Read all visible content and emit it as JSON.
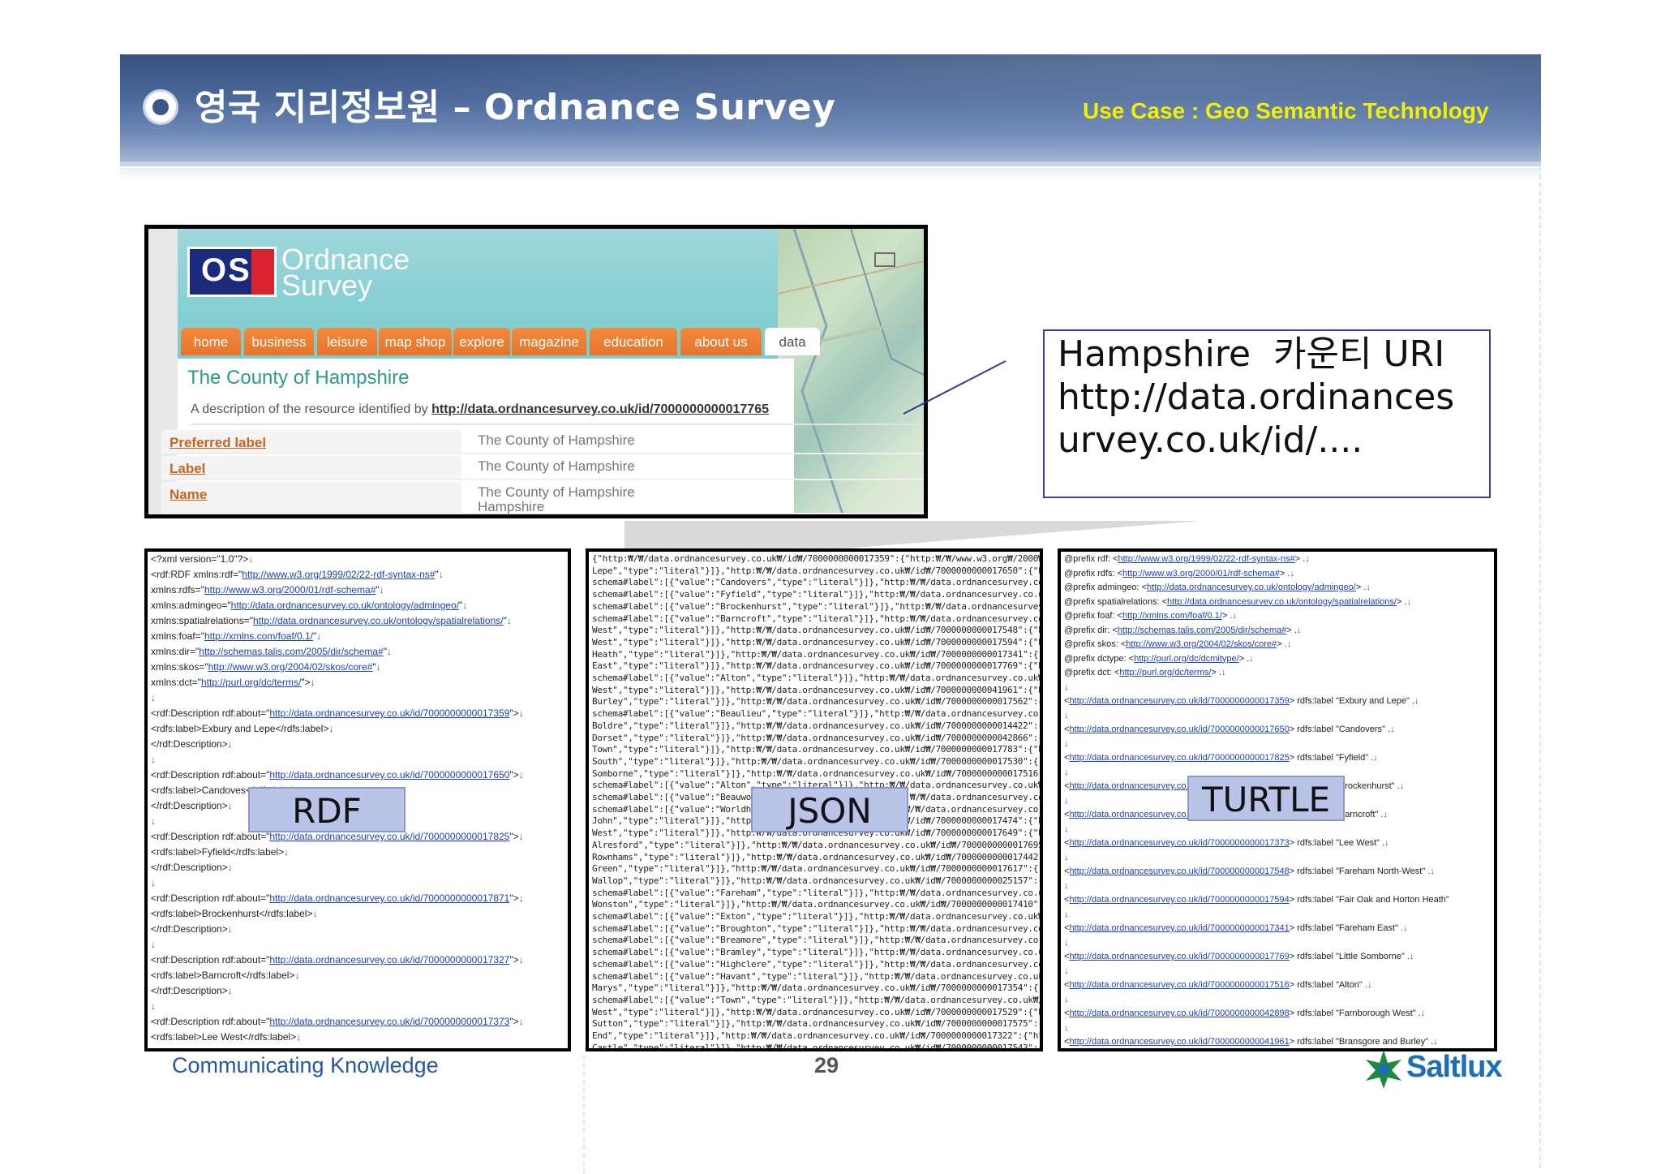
{
  "header": {
    "title": "영국 지리정보원 – Ordnance Survey",
    "use_case": "Use Case : Geo Semantic Technology"
  },
  "os_site": {
    "logo_mark": "OS",
    "logo_line1": "Ordnance",
    "logo_line2": "Survey",
    "nav": [
      "home",
      "business",
      "leisure",
      "map shop",
      "explore",
      "magazine",
      "education",
      "about us",
      "data"
    ],
    "active_tab": "data",
    "heading": "The County of Hampshire",
    "description_prefix": "A description of the resource identified by",
    "description_uri": "http://data.ordnancesurvey.co.uk/id/7000000000017765",
    "rows": [
      {
        "key": "Preferred label",
        "value": "The County of Hampshire"
      },
      {
        "key": "Label",
        "value": "The County of Hampshire"
      },
      {
        "key": "Name",
        "value": "The County of Hampshire",
        "value2": "Hampshire"
      }
    ]
  },
  "callout": {
    "text": "Hampshire  카운티 URI\nhttp://data.ordinancesurvey.co.uk/id/...."
  },
  "panels": {
    "rdf_label": "RDF",
    "json_label": "JSON",
    "turtle_label": "TURTLE",
    "rdf_lines": [
      "<?xml version=\"1.0\"?>↓",
      "<rdf:RDF xmlns:rdf=\"|http://www.w3.org/1999/02/22-rdf-syntax-ns#|\"↓",
      "   xmlns:rdfs=\"|http://www.w3.org/2000/01/rdf-schema#|\"↓",
      "   xmlns:admingeo=\"|http://data.ordnancesurvey.co.uk/ontology/admingeo/|\"↓",
      "   xmlns:spatialrelations=\"|http://data.ordnancesurvey.co.uk/ontology/spatialrelations/|\"↓",
      "   xmlns:foaf=\"|http://xmlns.com/foaf/0.1/|\"↓",
      "   xmlns:dir=\"|http://schemas.talis.com/2005/dir/schema#|\"↓",
      "   xmlns:skos=\"|http://www.w3.org/2004/02/skos/core#|\"↓",
      "   xmlns:dct=\"|http://purl.org/dc/terms/|\">↓",
      "↓",
      "  <rdf:Description rdf:about=\"|http://data.ordnancesurvey.co.uk/id/7000000000017359|\">↓",
      "    <rdfs:label>Exbury and Lepe</rdfs:label>↓",
      "  </rdf:Description>↓",
      "↓",
      "  <rdf:Description rdf:about=\"|http://data.ordnancesurvey.co.uk/id/7000000000017650|\">↓",
      "    <rdfs:label>Candoves</rdfs:label>↓",
      "  </rdf:Description>↓",
      "↓",
      "  <rdf:Description rdf:about=\"|http://data.ordnancesurvey.co.uk/id/7000000000017825|\">↓",
      "    <rdfs:label>Fyfield</rdfs:label>↓",
      "  </rdf:Description>↓",
      "↓",
      "  <rdf:Description rdf:about=\"|http://data.ordnancesurvey.co.uk/id/7000000000017871|\">↓",
      "    <rdfs:label>Brockenhurst</rdfs:label>↓",
      "  </rdf:Description>↓",
      "↓",
      "  <rdf:Description rdf:about=\"|http://data.ordnancesurvey.co.uk/id/7000000000017327|\">↓",
      "    <rdfs:label>Barncroft</rdfs:label>↓",
      "  </rdf:Description>↓",
      "↓",
      "  <rdf:Description rdf:about=\"|http://data.ordnancesurvey.co.uk/id/7000000000017373|\">↓",
      "    <rdfs:label>Lee West</rdfs:label>↓"
    ],
    "json_lines": [
      "{\"http:₩/₩/data.ordnancesurvey.co.uk₩/id₩/7000000000017359\":{\"http:₩/₩/www.w3.org₩/2000₩/01₩/rd",
      "Lepe\",\"type\":\"literal\"}]},\"http:₩/₩/data.ordnancesurvey.co.uk₩/id₩/7000000000017650\":{\"http:₩/₩/",
      "schema#label\":[{\"value\":\"Candovers\",\"type\":\"literal\"}]},\"http:₩/₩/data.ordnancesurvey.co.uk₩/id₩/",
      "schema#label\":[{\"value\":\"Fyfield\",\"type\":\"literal\"}]},\"http:₩/₩/data.ordnancesurvey.co.uk₩/id₩/7",
      "schema#label\":[{\"value\":\"Brockenhurst\",\"type\":\"literal\"}]},\"http:₩/₩/data.ordnancesurvey.co.uk₩/",
      "schema#label\":[{\"value\":\"Barncroft\",\"type\":\"literal\"}]},\"http:₩/₩/data.ordnancesurvey.co.uk₩/id₩",
      "West\",\"type\":\"literal\"}]},\"http:₩/₩/data.ordnancesurvey.co.uk₩/id₩/7000000000017548\":{\"http:₩/₩/",
      "West\",\"type\":\"literal\"}]},\"http:₩/₩/data.ordnancesurvey.co.uk₩/id₩/7000000000017594\":{\"http:₩/₩/",
      "Heath\",\"type\":\"literal\"}]},\"http:₩/₩/data.ordnancesurvey.co.uk₩/id₩/7000000000017341\":{\"http:₩/₩",
      "East\",\"type\":\"literal\"}]},\"http:₩/₩/data.ordnancesurvey.co.uk₩/id₩/7000000000017769\":{\"http:₩/₩/",
      "schema#label\":[{\"value\":\"Alton\",\"type\":\"literal\"}]},\"http:₩/₩/data.ordnancesurvey.co.uk₩/id₩/70",
      "West\",\"type\":\"literal\"}]},\"http:₩/₩/data.ordnancesurvey.co.uk₩/id₩/7000000000041961\":{\"http:₩/₩/",
      "Burley\",\"type\":\"literal\"}]},\"http:₩/₩/data.ordnancesurvey.co.uk₩/id₩/7000000000017562\":{\"http:₩/",
      "schema#label\":[{\"value\":\"Beaulieu\",\"type\":\"literal\"}]},\"http:₩/₩/data.ordnancesurvey.co.uk₩/id₩",
      "Boldre\",\"type\":\"literal\"}]},\"http:₩/₩/data.ordnancesurvey.co.uk₩/id₩/7000000000014422\":{\"http:₩/",
      "Dorset\",\"type\":\"literal\"}]},\"http:₩/₩/data.ordnancesurvey.co.uk₩/id₩/7000000000042866\":{\"http:₩/",
      "Town\",\"type\":\"literal\"}]},\"http:₩/₩/data.ordnancesurvey.co.uk₩/id₩/7000000000017783\":{\"http:₩/₩/",
      "South\",\"type\":\"literal\"}]},\"http:₩/₩/data.ordnancesurvey.co.uk₩/id₩/7000000000017530\":{\"http:₩/₩",
      "Somborne\",\"type\":\"literal\"}]},\"http:₩/₩/data.ordnancesurvey.co.uk₩/id₩/7000000000017516\":{\"http",
      "schema#label\":[{\"value\":\"Alton\",\"type\":\"literal\"}]},\"http:₩/₩/data.ordnancesurvey.co.uk₩/id₩/70",
      "schema#label\":[{\"value\":\"Beauworth\",\"type\":\"literal\"}]},\"http:₩/₩/data.ordnancesurvey.co.uk₩/id",
      "schema#label\":[{\"value\":\"Worldham\",\"type\":\"literal\"}]},\"http:₩/₩/data.ordnancesurvey.co.uk₩/id₩",
      "John\",\"type\":\"literal\"}]},\"http:₩/₩/data.ordnancesurvey.co.uk₩/id₩/7000000000017474\":{\"http:₩/₩/",
      "West\",\"type\":\"literal\"}]},\"http:₩/₩/data.ordnancesurvey.co.uk₩/id₩/7000000000017649\":{\"http:₩/₩/",
      "Alresford\",\"type\":\"literal\"}]},\"http:₩/₩/data.ordnancesurvey.co.uk₩/id₩/7000000000017695\":{\"http",
      "Rownhams\",\"type\":\"literal\"}]},\"http:₩/₩/data.ordnancesurvey.co.uk₩/id₩/7000000000017442\":{\"http",
      "Green\",\"type\":\"literal\"}]},\"http:₩/₩/data.ordnancesurvey.co.uk₩/id₩/7000000000017617\":{\"http:₩/₩",
      "Wallop\",\"type\":\"literal\"}]},\"http:₩/₩/data.ordnancesurvey.co.uk₩/id₩/7000000000025157\":{\"http:₩/",
      "schema#label\":[{\"value\":\"Fareham\",\"type\":\"literal\"}]},\"http:₩/₩/data.ordnancesurvey.co.uk₩/id₩/",
      "Wonston\",\"type\":\"literal\"}]},\"http:₩/₩/data.ordnancesurvey.co.uk₩/id₩/7000000000017410\":{\"http:₩",
      "schema#label\":[{\"value\":\"Exton\",\"type\":\"literal\"}]},\"http:₩/₩/data.ordnancesurvey.co.uk₩/id₩/70",
      "schema#label\":[{\"value\":\"Broughton\",\"type\":\"literal\"}]},\"http:₩/₩/data.ordnancesurvey.co.uk₩/id",
      "schema#label\":[{\"value\":\"Breamore\",\"type\":\"literal\"}]},\"http:₩/₩/data.ordnancesurvey.co.uk₩/id₩",
      "schema#label\":[{\"value\":\"Bramley\",\"type\":\"literal\"}]},\"http:₩/₩/data.ordnancesurvey.co.uk₩/id₩/",
      "schema#label\":[{\"value\":\"Highclere\",\"type\":\"literal\"}]},\"http:₩/₩/data.ordnancesurvey.co.uk₩/id",
      "schema#label\":[{\"value\":\"Havant\",\"type\":\"literal\"}]},\"http:₩/₩/data.ordnancesurvey.co.uk₩/id₩/7",
      "Marys\",\"type\":\"literal\"}]},\"http:₩/₩/data.ordnancesurvey.co.uk₩/id₩/7000000000017354\":{\"http:₩/₩",
      "schema#label\":[{\"value\":\"Town\",\"type\":\"literal\"}]},\"http:₩/₩/data.ordnancesurvey.co.uk₩/id₩/700",
      "West\",\"type\":\"literal\"}]},\"http:₩/₩/data.ordnancesurvey.co.uk₩/id₩/7000000000017529\":{\"http:₩/₩/",
      "Sutton\",\"type\":\"literal\"}]},\"http:₩/₩/data.ordnancesurvey.co.uk₩/id₩/7000000000017575\":{\"http:₩/",
      "End\",\"type\":\"literal\"}]},\"http:₩/₩/data.ordnancesurvey.co.uk₩/id₩/7000000000017322\":{\"http:₩/₩/",
      "Castle\",\"type\":\"literal\"}]},\"http:₩/₩/data.ordnancesurvey.co.uk₩/id₩/7000000000017543\":{\"http:₩/"
    ],
    "turtle_lines": [
      "@prefix rdf: <|http://www.w3.org/1999/02/22-rdf-syntax-ns#|> .↓",
      "@prefix rdfs: <|http://www.w3.org/2000/01/rdf-schema#|> .↓",
      "@prefix admingeo: <|http://data.ordnancesurvey.co.uk/ontology/admingeo/|> .↓",
      "@prefix spatialrelations: <|http://data.ordnancesurvey.co.uk/ontology/spatialrelations/|> .↓",
      "@prefix foaf: <|http://xmlns.com/foaf/0.1/|> .↓",
      "@prefix dir: <|http://schemas.talis.com/2005/dir/schema#|> .↓",
      "@prefix skos: <|http://www.w3.org/2004/02/skos/core#|> .↓",
      "@prefix dctype: <|http://purl.org/dc/dcmitype/|> .↓",
      "@prefix dct: <|http://purl.org/dc/terms/|> .↓",
      "↓",
      "<|http://data.ordnancesurvey.co.uk/id/7000000000017359|> rdfs:label \"Exbury and Lepe\" .↓",
      "↓",
      "<|http://data.ordnancesurvey.co.uk/id/7000000000017650|> rdfs:label \"Candovers\" .↓",
      "↓",
      "<|http://data.ordnancesurvey.co.uk/id/7000000000017825|> rdfs:label \"Fyfield\" .↓",
      "↓",
      "<|http://data.ordnancesurvey.co.uk/id/7000000000017871|> rdfs:label \"Brockenhurst\" .↓",
      "↓",
      "<|http://data.ordnancesurvey.co.uk/id/7000000000017327|> rdfs:label \"Barncroft\" .↓",
      "↓",
      "<|http://data.ordnancesurvey.co.uk/id/7000000000017373|> rdfs:label \"Lee West\" .↓",
      "↓",
      "<|http://data.ordnancesurvey.co.uk/id/7000000000017548|> rdfs:label \"Fareham North-West\" .↓",
      "↓",
      "<|http://data.ordnancesurvey.co.uk/id/7000000000017594|> rdfs:label \"Fair Oak and Horton Heath\"",
      "↓",
      "<|http://data.ordnancesurvey.co.uk/id/7000000000017341|> rdfs:label \"Fareham East\" .↓",
      "↓",
      "<|http://data.ordnancesurvey.co.uk/id/7000000000017769|> rdfs:label \"Little Somborne\" .↓",
      "↓",
      "<|http://data.ordnancesurvey.co.uk/id/7000000000017516|> rdfs:label \"Alton\" .↓",
      "↓",
      "<|http://data.ordnancesurvey.co.uk/id/7000000000042898|> rdfs:label \"Farnborough West\" .↓",
      "↓",
      "<|http://data.ordnancesurvey.co.uk/id/7000000000041961|> rdfs:label \"Bransgore and Burley\" .↓"
    ]
  },
  "footer": {
    "tagline": "Communicating Knowledge",
    "page": "29",
    "brand": "Saltlux"
  }
}
